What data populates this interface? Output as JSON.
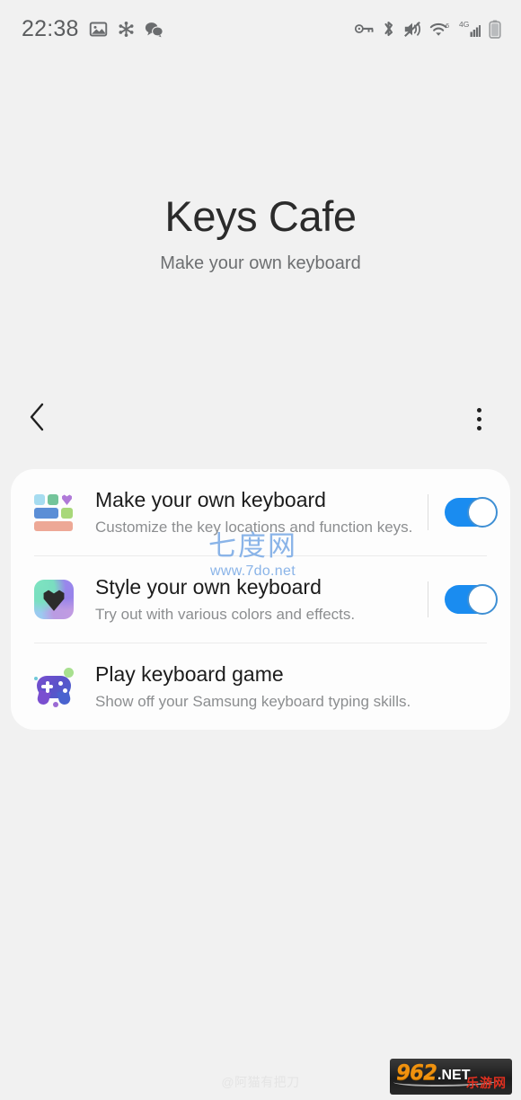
{
  "status_bar": {
    "time": "22:38",
    "left_icons": [
      "image-icon",
      "asterisk-icon",
      "wechat-icon"
    ],
    "right_icons": [
      "vpn-key-icon",
      "bluetooth-icon",
      "mute-vibrate-icon",
      "wifi-icon",
      "signal-4g-icon",
      "battery-icon"
    ],
    "wifi_label": "6",
    "network_label": "4G"
  },
  "header": {
    "title": "Keys Cafe",
    "subtitle": "Make your own keyboard"
  },
  "nav": {
    "back_label": "Back",
    "overflow_label": "More options"
  },
  "list": {
    "items": [
      {
        "icon": "colored-keys-icon",
        "title": "Make your own keyboard",
        "description": "Customize the key locations and function keys.",
        "toggle": true,
        "toggle_state": "on"
      },
      {
        "icon": "gradient-heart-icon",
        "title": "Style your own keyboard",
        "description": "Try out with various colors and effects.",
        "toggle": true,
        "toggle_state": "on"
      },
      {
        "icon": "gamepad-icon",
        "title": "Play keyboard game",
        "description": "Show off your Samsung keyboard typing skills.",
        "toggle": false,
        "toggle_state": ""
      }
    ]
  },
  "watermarks": {
    "site_cn": "七度网",
    "site_url": "www.7do.net",
    "weibo": "@阿猫有把刀",
    "logo_number": "962",
    "logo_domain": ".NET",
    "logo_cn": "乐游网"
  },
  "colors": {
    "background": "#f1f1f1",
    "card": "#fdfdfd",
    "accent_toggle": "#1a8cf0",
    "title_text": "#2b2b2b",
    "subtitle_text": "#6d6f71",
    "description_text": "#8c8e90",
    "watermark_blue": "#8ab4e8",
    "logo_orange": "#f0920f",
    "logo_red": "#e03020"
  }
}
